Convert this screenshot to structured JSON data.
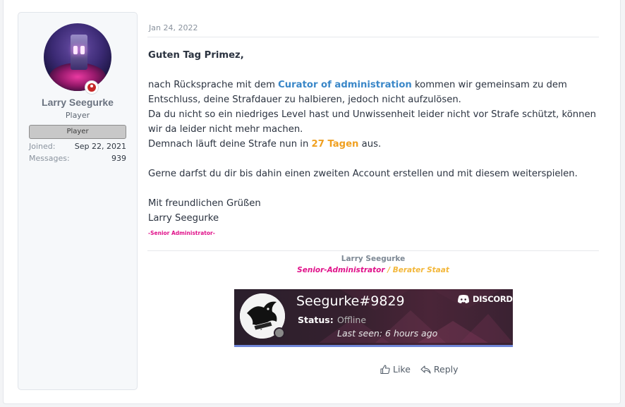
{
  "user": {
    "username": "Larry Seegurke",
    "title": "Player",
    "banner": "Player",
    "stats": [
      {
        "label": "Joined:",
        "value": "Sep 22, 2021"
      },
      {
        "label": "Messages:",
        "value": "939"
      }
    ]
  },
  "post": {
    "date": "Jan 24, 2022",
    "greeting": "Guten Tag Primez,",
    "para1_a": "nach Rücksprache mit dem ",
    "para1_link": "Curator of administration",
    "para1_b": " kommen wir gemeinsam zu dem Entschluss, deine Strafdauer zu halbieren, jedoch nicht aufzulösen.",
    "para2": "Da du nicht so ein niedriges Level hast und Unwissenheit leider nicht vor Strafe schützt, können wir da leider nicht mehr machen.",
    "para3_a": "Demnach läuft deine Strafe nun in ",
    "para3_highlight": "27 Tagen",
    "para3_b": " aus.",
    "para4": "Gerne darfst du dir bis dahin einen zweiten Account erstellen und mit diesem weiterspielen.",
    "closing": "Mit freundlichen Grüßen",
    "closing_name": "Larry Seegurke",
    "role_tag": "-Senior Administrator-"
  },
  "signature": {
    "name": "Larry Seegurke",
    "role_main": "Senior-Administrator",
    "separator": " / ",
    "role_secondary": "Berater Staat"
  },
  "discord_widget": {
    "tag": "Seegurke#9829",
    "brand": "DISCORD",
    "status_label": "Status:",
    "status_value": "Offline",
    "last_seen": "Last seen: 6 hours ago"
  },
  "actions": {
    "like": "Like",
    "reply": "Reply"
  },
  "colors": {
    "link": "#3a87c8",
    "highlight": "#f0a020",
    "role_pink": "#e0128a",
    "role_yellow": "#f3b73a",
    "discord_accent": "#6f86d8"
  }
}
